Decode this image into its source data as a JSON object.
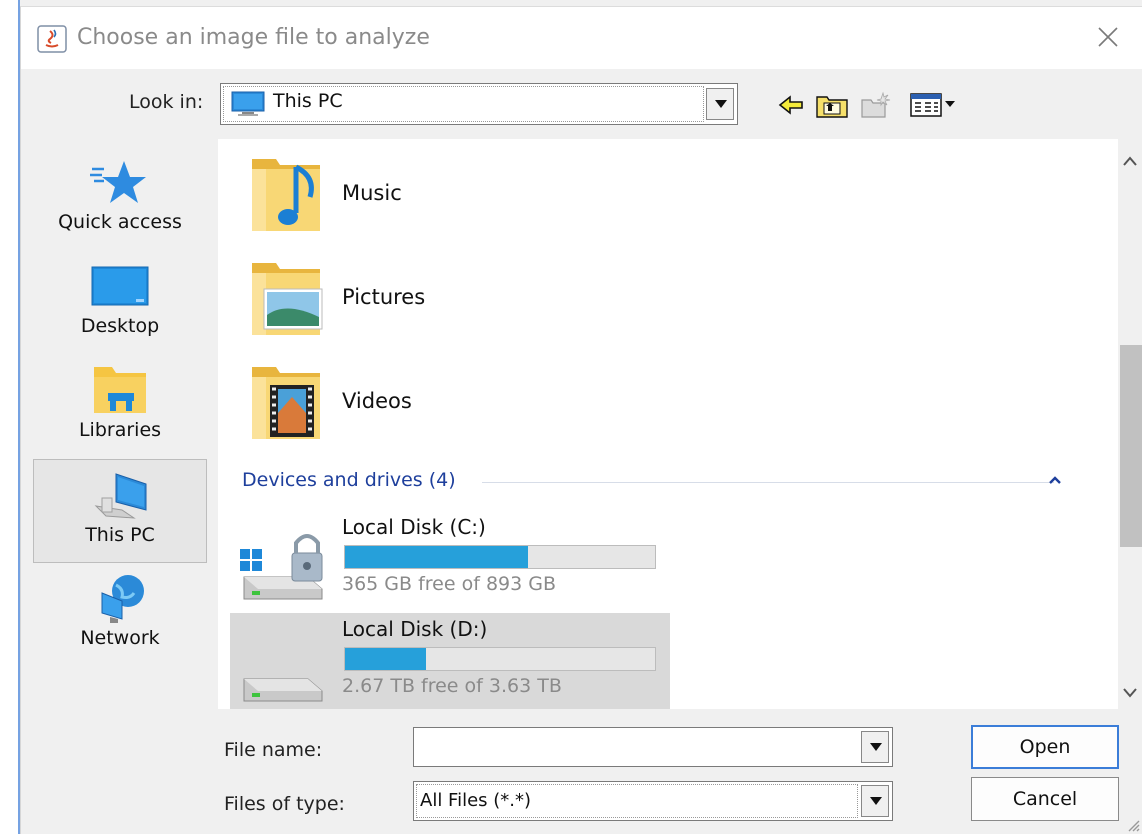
{
  "window": {
    "title": "Choose an image file to analyze"
  },
  "lookin": {
    "label": "Look in:",
    "value": "This PC"
  },
  "toolbar": {
    "buttons": [
      {
        "name": "back-icon"
      },
      {
        "name": "up-one-level-icon"
      },
      {
        "name": "create-new-folder-icon"
      },
      {
        "name": "view-menu-icon"
      }
    ]
  },
  "places": [
    {
      "label": "Quick access",
      "icon": "star-icon"
    },
    {
      "label": "Desktop",
      "icon": "desktop-icon"
    },
    {
      "label": "Libraries",
      "icon": "libraries-icon"
    },
    {
      "label": "This PC",
      "icon": "computer-icon",
      "selected": true
    },
    {
      "label": "Network",
      "icon": "network-icon"
    }
  ],
  "folders": [
    {
      "name": "Music",
      "icon": "music-folder-icon"
    },
    {
      "name": "Pictures",
      "icon": "pictures-folder-icon"
    },
    {
      "name": "Videos",
      "icon": "videos-folder-icon"
    }
  ],
  "group": {
    "title": "Devices and drives (4)"
  },
  "drives": [
    {
      "name": "Local Disk (C:)",
      "free": "365 GB free of 893 GB",
      "used_fraction": 0.59,
      "selected": false
    },
    {
      "name": "Local Disk (D:)",
      "free": "2.67 TB free of 3.63 TB",
      "used_fraction": 0.26,
      "selected": true
    }
  ],
  "filename": {
    "label": "File name:",
    "value": ""
  },
  "filetype": {
    "label": "Files of type:",
    "value": "All Files (*.*)"
  },
  "buttons": {
    "open": "Open",
    "cancel": "Cancel"
  },
  "colors": {
    "accent": "#26a0da",
    "group_title": "#1e3f9c",
    "default_button_border": "#3b7dd8"
  }
}
